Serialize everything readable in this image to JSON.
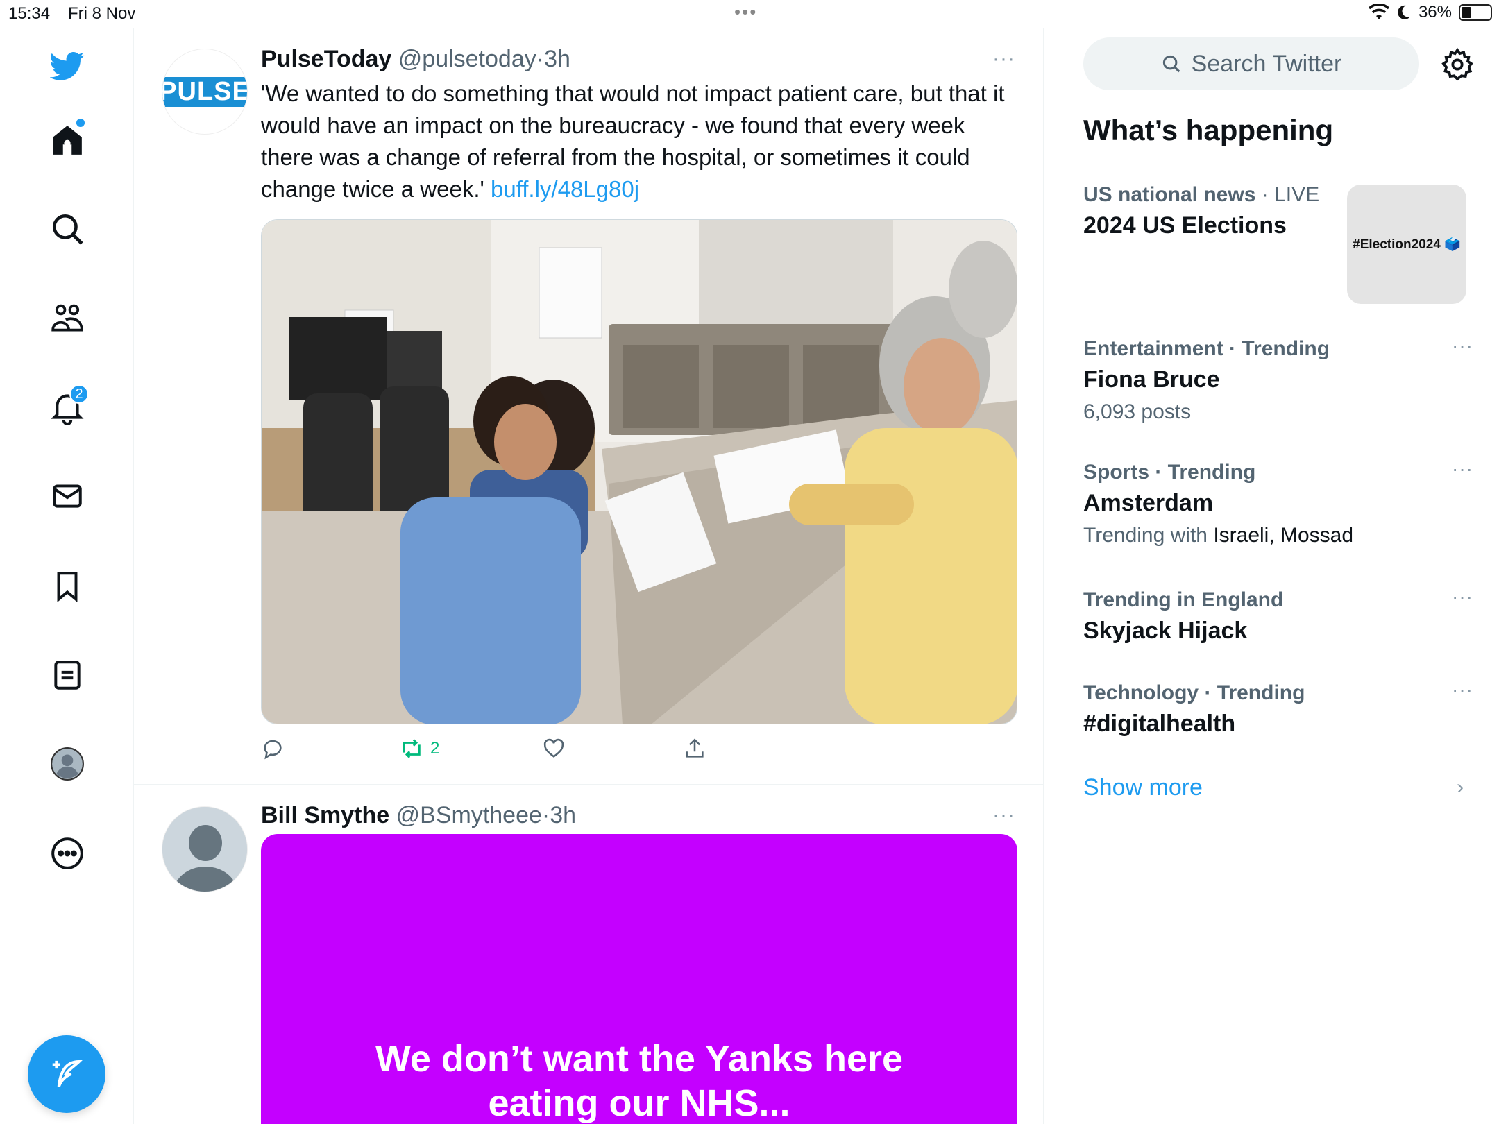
{
  "status_bar": {
    "time": "15:34",
    "date": "Fri 8 Nov",
    "battery": "36%",
    "battery_level": 0.36
  },
  "nav": {
    "notifications_badge": "2",
    "items": [
      "twitter-logo",
      "home",
      "explore",
      "communities",
      "notifications",
      "messages",
      "bookmarks",
      "lists",
      "profile",
      "more"
    ]
  },
  "tweets": [
    {
      "name": "PulseToday",
      "handle": "@pulsetoday",
      "sep": "·",
      "time": "3h",
      "avatar_text": "PULSE",
      "text": "'We wanted to do something that would not impact patient care, but that it would have an impact on the bureaucracy - we found that every week there was a change of referral from the hospital, or sometimes it could change twice a week.' ",
      "link": "buff.ly/48Lg80j",
      "retweet_count": "2",
      "more": "···"
    },
    {
      "name": "Bill Smythe",
      "handle": "@BSmytheee",
      "sep": "·",
      "time": "3h",
      "media_text": "We don’t want the Yanks here eating our NHS...",
      "more": "···"
    }
  ],
  "sidebar": {
    "search_placeholder": "Search Twitter",
    "section_title": "What’s happening",
    "trends": [
      {
        "category": "US national news",
        "status": "· LIVE",
        "title": "2024 US Elections",
        "thumb": "#Election2024 🗳️"
      },
      {
        "category": "Entertainment · Trending",
        "title": "Fiona Bruce",
        "sub": "6,093 posts"
      },
      {
        "category": "Sports · Trending",
        "title": "Amsterdam",
        "sub_prefix": "Trending with ",
        "sub_names": "Israeli, Mossad"
      },
      {
        "category": "Trending in England",
        "title": "Skyjack Hijack"
      },
      {
        "category": "Technology · Trending",
        "title": "#digitalhealth"
      }
    ],
    "more_dots": "···",
    "show_more": "Show more"
  }
}
